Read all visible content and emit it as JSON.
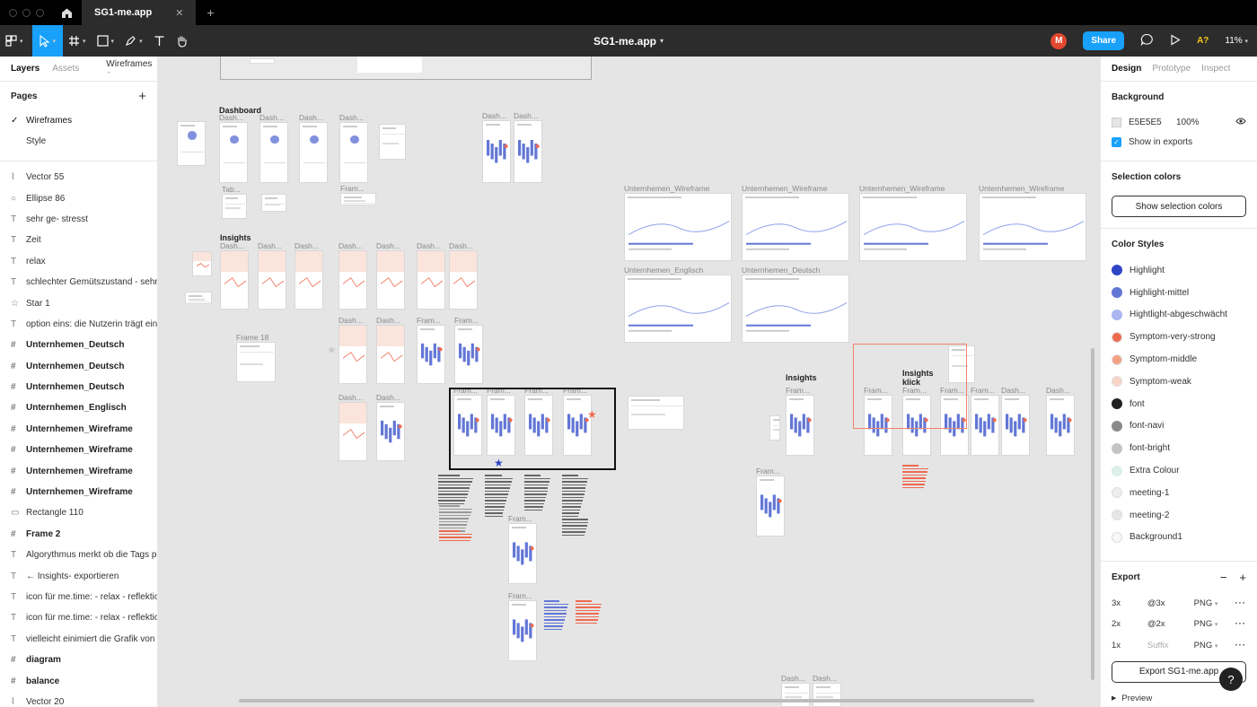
{
  "tabbar": {
    "home_icon": "home-icon",
    "tab_title": "SG1-me.app",
    "close": "✕",
    "plus": "+"
  },
  "toolbar": {
    "document_title": "SG1-me.app",
    "share_label": "Share",
    "avatar_initial": "M",
    "ax_label": "A?",
    "zoom": "11%"
  },
  "left_panel": {
    "tab_layers": "Layers",
    "tab_assets": "Assets",
    "page_picker": "Wireframes",
    "pages_heading": "Pages",
    "pages": [
      "Wireframes",
      "Style"
    ],
    "layers": [
      {
        "icon": "vector",
        "label": "Vector 55"
      },
      {
        "icon": "ellipse",
        "label": "Ellipse 86"
      },
      {
        "icon": "text",
        "label": "sehr ge- stresst"
      },
      {
        "icon": "text",
        "label": "Zeit"
      },
      {
        "icon": "text",
        "label": "relax"
      },
      {
        "icon": "text",
        "label": "schlechter Gemütszustand - sehr ..."
      },
      {
        "icon": "star",
        "label": "Star 1"
      },
      {
        "icon": "text",
        "label": "option eins: die Nutzerin trägt ein ..."
      },
      {
        "icon": "frame",
        "label": "Unternhemen_Deutsch"
      },
      {
        "icon": "frame",
        "label": "Unternhemen_Deutsch"
      },
      {
        "icon": "frame",
        "label": "Unternhemen_Deutsch"
      },
      {
        "icon": "frame",
        "label": "Unternhemen_Englisch"
      },
      {
        "icon": "frame",
        "label": "Unternhemen_Wireframe"
      },
      {
        "icon": "frame",
        "label": "Unternhemen_Wireframe"
      },
      {
        "icon": "frame",
        "label": "Unternhemen_Wireframe"
      },
      {
        "icon": "frame",
        "label": "Unternhemen_Wireframe"
      },
      {
        "icon": "rect",
        "label": "Rectangle 110"
      },
      {
        "icon": "frame",
        "label": "Frame 2"
      },
      {
        "icon": "text",
        "label": "Algorythmus merkt ob die Tags po..."
      },
      {
        "icon": "text",
        "label": "← Insights- exportieren"
      },
      {
        "icon": "text",
        "label": "icon für me.time: - relax - reflektio..."
      },
      {
        "icon": "text",
        "label": "icon für me.time: - relax - reflektio..."
      },
      {
        "icon": "text",
        "label": "vielleicht einimiert die Grafik von s..."
      },
      {
        "icon": "frame",
        "label": "diagram"
      },
      {
        "icon": "frame",
        "label": "balance"
      },
      {
        "icon": "vector",
        "label": "Vector 20"
      }
    ]
  },
  "canvas": {
    "labels": {
      "dashboard": "Dashboard",
      "insights": "Insights",
      "insights2": "Insights",
      "insights_klick": "Insights klick",
      "dash": "Dash...",
      "fram": "Fram...",
      "tab": "Tab...",
      "frame18": "Frame 18",
      "u_wire": "Unternhemen_Wireframe",
      "u_engl": "Unternhemen_Englisch",
      "u_deut": "Unternhemen_Deutsch"
    }
  },
  "right_panel": {
    "tab_design": "Design",
    "tab_prototype": "Prototype",
    "tab_inspect": "Inspect",
    "background": {
      "title": "Background",
      "hex": "E5E5E5",
      "opacity": "100%",
      "show_in_exports": "Show in exports"
    },
    "selection_colors": {
      "title": "Selection colors",
      "button": "Show selection colors"
    },
    "color_styles": {
      "title": "Color Styles",
      "items": [
        {
          "name": "Highlight",
          "color": "#2f45c6"
        },
        {
          "name": "Highlight-mittel",
          "color": "#6276d6"
        },
        {
          "name": "Hightlight-abgeschwächt",
          "color": "#a9b6ef"
        },
        {
          "name": "Symptom-very-strong",
          "color": "#ef6a4f"
        },
        {
          "name": "Symptom-middle",
          "color": "#f4a083"
        },
        {
          "name": "Symptom-weak",
          "color": "#f9d4c6"
        },
        {
          "name": "font",
          "color": "#222222"
        },
        {
          "name": "font-navi",
          "color": "#8a8a8a"
        },
        {
          "name": "font-bright",
          "color": "#c4c4c4"
        },
        {
          "name": "Extra Colour",
          "color": "#dcefe9"
        },
        {
          "name": "meeting-1",
          "color": "#ededed"
        },
        {
          "name": "meeting-2",
          "color": "#e6e6e6"
        },
        {
          "name": "Background1",
          "color": "#f7f7f7"
        }
      ]
    },
    "export": {
      "title": "Export",
      "rows": [
        {
          "scale": "3x",
          "suffix": "@3x",
          "format": "PNG"
        },
        {
          "scale": "2x",
          "suffix": "@2x",
          "format": "PNG"
        },
        {
          "scale": "1x",
          "suffix": "Suffix",
          "format": "PNG"
        }
      ],
      "button": "Export SG1-me.app",
      "preview": "Preview"
    },
    "help": "?"
  }
}
